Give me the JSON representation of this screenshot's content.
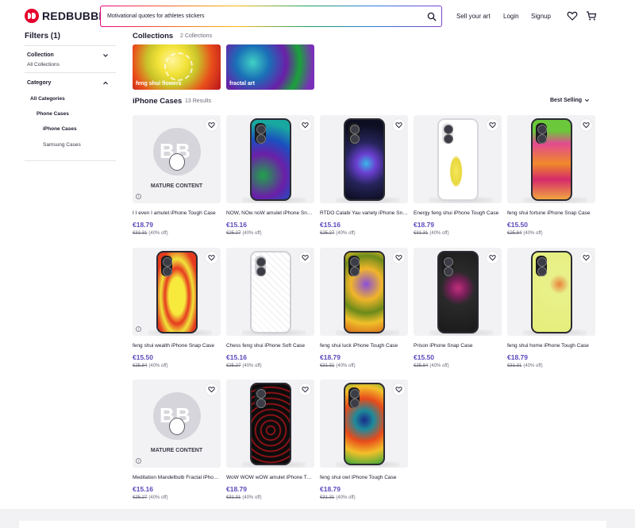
{
  "header": {
    "logo_text": "REDBUBBLE",
    "search_value": "Motivational quotes for athletes stickers",
    "sell_label": "Sell your art",
    "login_label": "Login",
    "signup_label": "Signup",
    "icons": [
      "search-icon",
      "heart-icon",
      "cart-icon"
    ]
  },
  "sidebar": {
    "title": "Filters (1)",
    "collection": {
      "heading": "Collection",
      "value": "All Collections"
    },
    "category": {
      "heading": "Category",
      "items": [
        "All Categories",
        "Phone Cases",
        "iPhone Cases",
        "Samsung Cases"
      ]
    }
  },
  "collections": {
    "title": "Collections",
    "count": "2 Collections",
    "items": [
      {
        "label": "feng shui flowers"
      },
      {
        "label": "fractal art"
      }
    ]
  },
  "results": {
    "title": "iPhone Cases",
    "count": "13 Results",
    "sort_label": "Best Selling",
    "mature_label": "MATURE CONTENT",
    "products": [
      {
        "title": "I I even I amulet iPhone Tough Case",
        "price": "€18.79",
        "was": "€31.31",
        "off": "(40% off)",
        "mature": true
      },
      {
        "title": "NOW, NOw noW amulet iPhone Snap Case",
        "price": "€15.16",
        "was": "€25.27",
        "off": "(40% off)",
        "mature": false
      },
      {
        "title": "RTDO Calabi Yau variety iPhone Snap Case",
        "price": "€15.16",
        "was": "€25.27",
        "off": "(40% off)",
        "mature": false
      },
      {
        "title": "Energy feng shui iPhone Tough Case",
        "price": "€18.79",
        "was": "€31.31",
        "off": "(40% off)",
        "mature": false
      },
      {
        "title": "feng shui fortune iPhone Snap Case",
        "price": "€15.50",
        "was": "€25.84",
        "off": "(40% off)",
        "mature": false
      },
      {
        "title": "feng shui wealth iPhone Snap Case",
        "price": "€15.50",
        "was": "€25.84",
        "off": "(40% off)",
        "mature": false
      },
      {
        "title": "Chess feng shui iPhone Soft Case",
        "price": "€15.16",
        "was": "€25.27",
        "off": "(40% off)",
        "mature": false
      },
      {
        "title": "feng shui luck iPhone Tough Case",
        "price": "€18.79",
        "was": "€31.31",
        "off": "(40% off)",
        "mature": false
      },
      {
        "title": "Prison iPhone Snap Case",
        "price": "€15.50",
        "was": "€25.84",
        "off": "(40% off)",
        "mature": false
      },
      {
        "title": "feng shui home iPhone Tough Case",
        "price": "€18.79",
        "was": "€31.31",
        "off": "(40% off)",
        "mature": false
      },
      {
        "title": "Meditation Mandelbulb Fractal iPhone Snap Case",
        "price": "€15.16",
        "was": "€25.27",
        "off": "(40% off)",
        "mature": true
      },
      {
        "title": "WoW WOW wOW amulet iPhone Tough Case",
        "price": "€18.79",
        "was": "€31.31",
        "off": "(40% off)",
        "mature": false
      },
      {
        "title": "feng shui owl iPhone Tough Case",
        "price": "€18.79",
        "was": "€31.31",
        "off": "(40% off)",
        "mature": false
      }
    ]
  },
  "colors": {
    "brand": "#e4002b",
    "price": "#5c4bbd",
    "text": "#1a1a2e"
  }
}
